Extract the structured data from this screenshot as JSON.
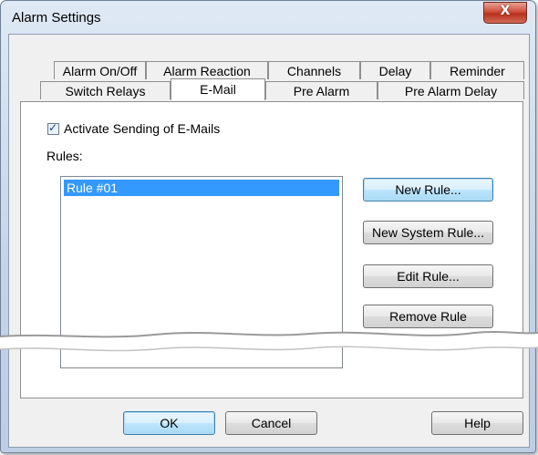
{
  "window": {
    "title": "Alarm Settings",
    "close_glyph": "X",
    "close_icon": "close-icon"
  },
  "tabs": {
    "row1": [
      "Alarm On/Off",
      "Alarm Reaction",
      "Channels",
      "Delay",
      "Reminder"
    ],
    "row2": [
      "Switch Relays",
      "E-Mail",
      "Pre Alarm",
      "Pre Alarm Delay"
    ],
    "active": "E-Mail"
  },
  "email": {
    "activate_label": "Activate Sending of E-Mails",
    "activate_checked": true,
    "checkmark": "✓",
    "rules_label": "Rules:",
    "rules": [
      "Rule #01"
    ],
    "selected_rule": "Rule #01"
  },
  "rule_buttons": {
    "new_rule": "New Rule...",
    "new_system_rule": "New System Rule...",
    "edit_rule": "Edit Rule...",
    "remove_rule": "Remove Rule"
  },
  "footer": {
    "ok": "OK",
    "cancel": "Cancel",
    "help": "Help"
  },
  "colors": {
    "selection": "#3399ff",
    "close_button": "#c7402b",
    "frame": "#c4d4e8"
  }
}
